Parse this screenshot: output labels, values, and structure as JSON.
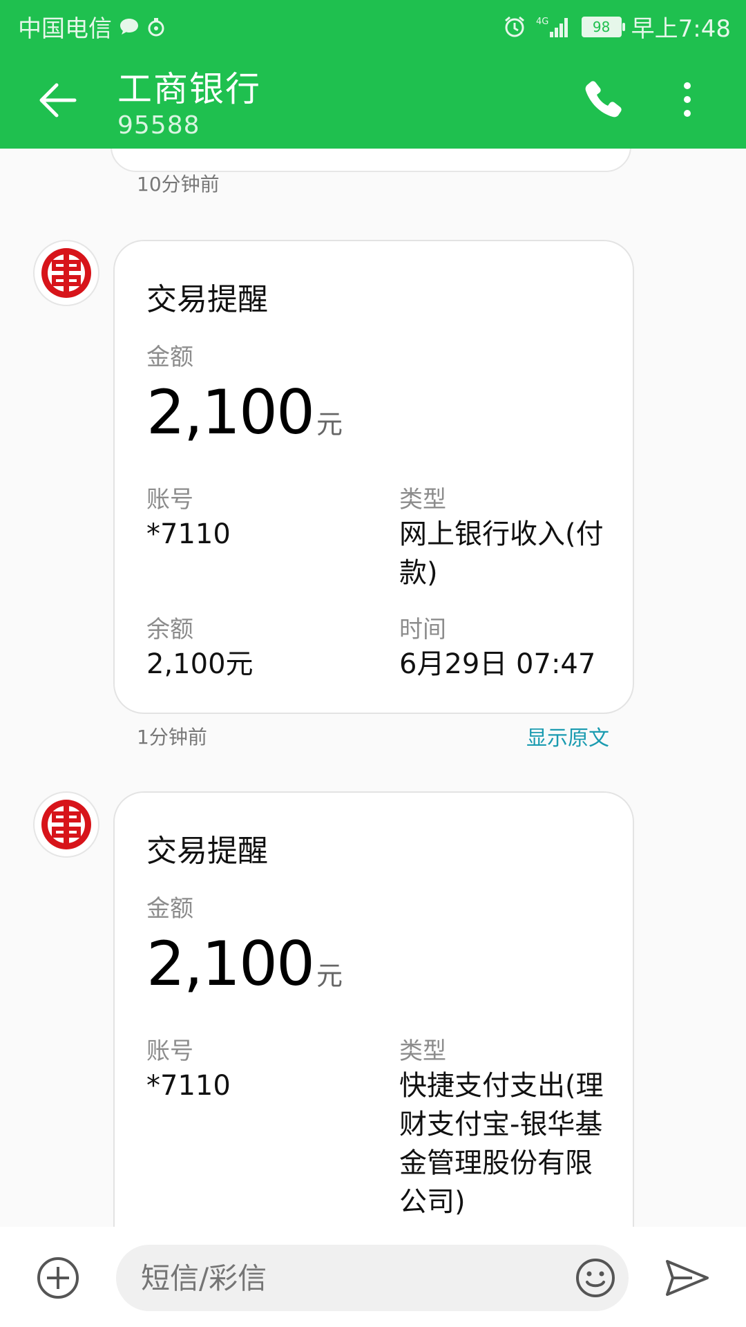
{
  "status": {
    "carrier": "中国电信",
    "signal": "4G",
    "battery": "98",
    "time": "早上7:48"
  },
  "header": {
    "title": "工商银行",
    "number": "95588"
  },
  "messages": {
    "prev_time": "10分钟前",
    "items": [
      {
        "title": "交易提醒",
        "amount_label": "金额",
        "amount": "2,100",
        "unit": "元",
        "account_label": "账号",
        "account": "*7110",
        "type_label": "类型",
        "type": "网上银行收入(付款)",
        "balance_label": "余额",
        "balance": "2,100元",
        "time_label": "时间",
        "time": "6月29日 07:47",
        "footer_time": "1分钟前",
        "show_original": "显示原文"
      },
      {
        "title": "交易提醒",
        "amount_label": "金额",
        "amount": "2,100",
        "unit": "元",
        "account_label": "账号",
        "account": "*7110",
        "type_label": "类型",
        "type": "快捷支付支出(理财支付宝-银华基金管理股份有限公司)"
      }
    ]
  },
  "input": {
    "placeholder": "短信/彩信"
  },
  "colors": {
    "header_green": "#1fc04f",
    "link_teal": "#1a9bb0",
    "icbc_red": "#d7141a"
  },
  "icons": [
    "back-arrow-icon",
    "phone-icon",
    "more-vert-icon",
    "icbc-logo-icon",
    "add-icon",
    "emoji-icon",
    "send-icon"
  ]
}
